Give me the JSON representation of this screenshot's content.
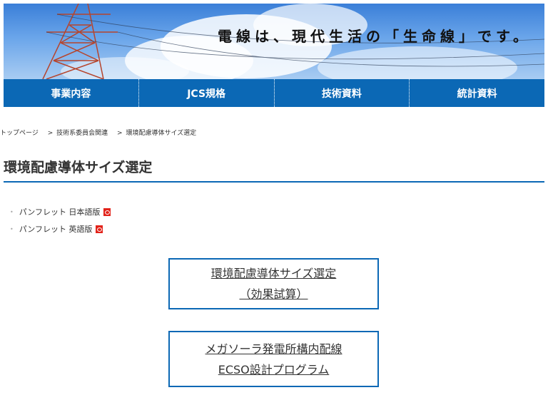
{
  "hero": {
    "tagline": "電線は、現代生活の「生命線」です。"
  },
  "nav": {
    "items": [
      {
        "label": "事業内容"
      },
      {
        "label": "JCS規格"
      },
      {
        "label": "技術資料"
      },
      {
        "label": "統計資料"
      }
    ]
  },
  "breadcrumb": {
    "items": [
      "トップページ",
      "技術系委員会関連",
      "環境配慮導体サイズ選定"
    ],
    "separator": ">"
  },
  "page": {
    "title": "環境配慮導体サイズ選定"
  },
  "links": {
    "bullet": "•",
    "items": [
      {
        "label": "パンフレット 日本語版",
        "icon": "pdf-icon"
      },
      {
        "label": "パンフレット 英語版",
        "icon": "pdf-icon"
      }
    ]
  },
  "buttons": {
    "calc": {
      "line1": "環境配慮導体サイズ選定",
      "line2": "（効果試算）"
    },
    "ecso": {
      "line1": "メガソーラ発電所構内配線",
      "line2": "ECSO設計プログラム"
    }
  },
  "colors": {
    "brand": "#0b68b5",
    "pdf": "#e2231a"
  }
}
